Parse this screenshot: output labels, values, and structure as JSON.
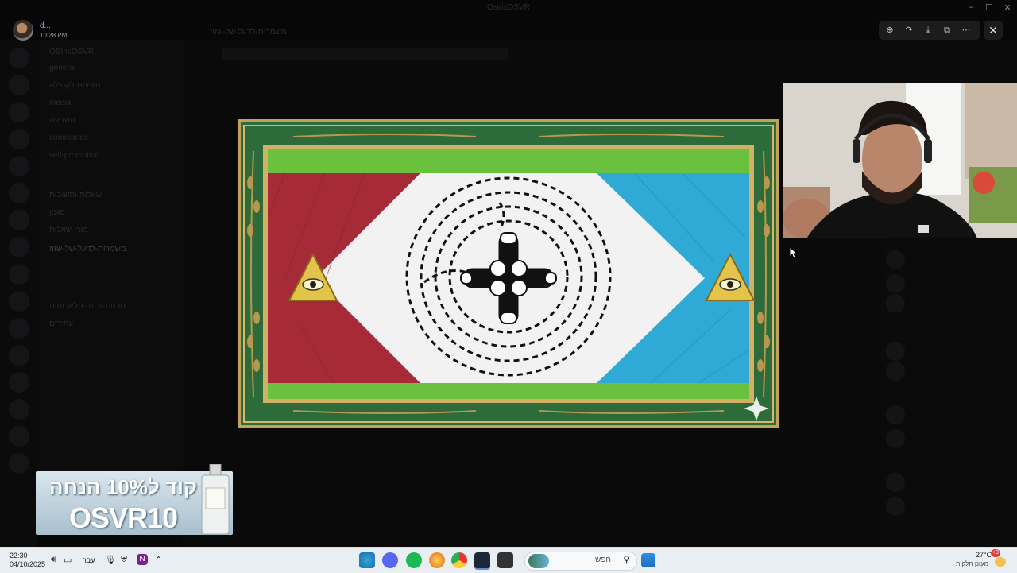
{
  "window": {
    "title": "OsirisOSVR"
  },
  "user": {
    "name": "d...",
    "time": "10:28 PM"
  },
  "server": {
    "header": "OSIrisOSVR"
  },
  "channel": {
    "title": "משמרות-לדעל-של-שזוז"
  },
  "channels": [
    "general",
    "הודעות-לקהילה",
    "media",
    "השמעה",
    "commands",
    "self-promotion",
    "שאלות-ותשובות",
    "סגנון",
    "מורי-שאלות",
    "משמרות-לדעל-של-שזוז",
    "תכנות-ובינה-מלאכותית",
    "עתידים"
  ],
  "promo": {
    "line1": "קוד ל10% הנחה",
    "line2": "OSVR10"
  },
  "taskbar": {
    "time": "22:30",
    "date": "04/10/2025",
    "language": "עבר",
    "search_placeholder": "חפש",
    "weather_temp": "27°C",
    "weather_desc": "מעונן חלקית",
    "notification_count": "+9"
  },
  "viewer_tools": [
    "zoom-icon",
    "forward-icon",
    "download-icon",
    "open-external-icon",
    "more-icon"
  ],
  "colors": {
    "flag_red": "#a62a38",
    "flag_blue": "#2fa9d6",
    "flag_green": "#6ac13d",
    "frame_green": "#2d6b3a",
    "gold": "#c2a15a"
  }
}
